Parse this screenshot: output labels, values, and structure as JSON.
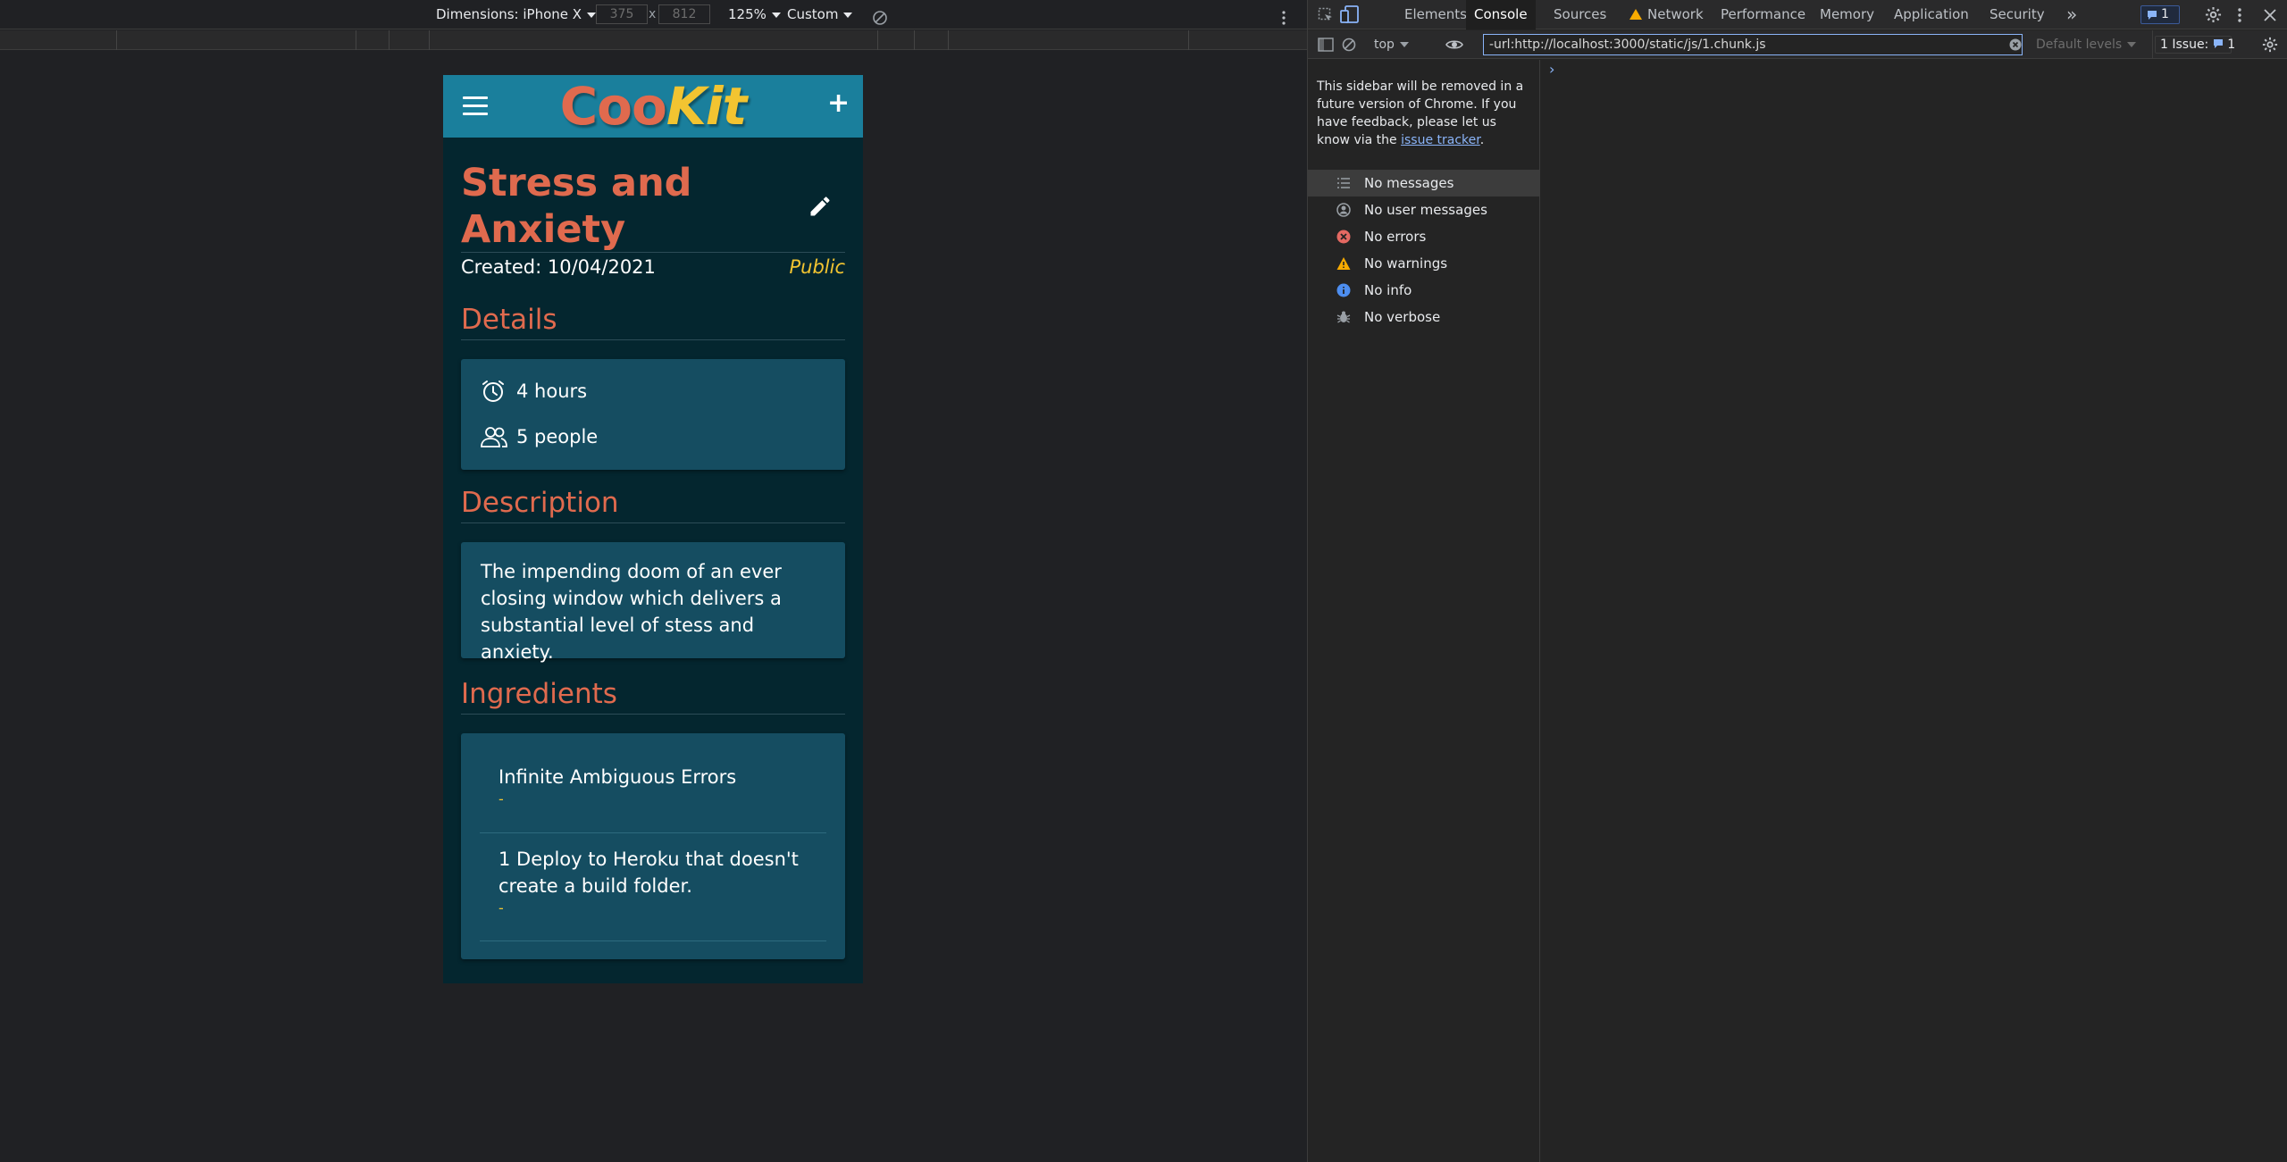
{
  "device_toolbar": {
    "dimensions_label": "Dimensions: iPhone X",
    "width_value": "375",
    "height_value": "812",
    "times": "x",
    "zoom_label": "125%",
    "throttle_label": "Custom"
  },
  "app": {
    "logo_part1": "Coo",
    "logo_part2": "Kit",
    "recipe": {
      "title": "Stress and Anxiety",
      "created": "Created: 10/04/2021",
      "visibility": "Public"
    },
    "sections": {
      "details": "Details",
      "description": "Description",
      "ingredients": "Ingredients"
    },
    "details": {
      "time": "4 hours",
      "servings": "5 people"
    },
    "description": "The impending doom of an ever closing window which delivers a substantial level of stess and anxiety.",
    "ingredients": [
      {
        "name": "Infinite Ambiguous Errors",
        "note": "-"
      },
      {
        "name": "1 Deploy to Heroku that doesn't create a build folder.",
        "note": "-"
      }
    ]
  },
  "devtools": {
    "tabs": [
      "Elements",
      "Console",
      "Sources",
      "Network",
      "Performance",
      "Memory",
      "Application",
      "Security"
    ],
    "active_tab": "Console",
    "more_tabs": "»",
    "issues_badge": "1",
    "context": "top",
    "filter_value": "-url:http://localhost:3000/static/js/1.chunk.js",
    "levels": "Default levels",
    "issues_label": "1 Issue:",
    "issues_count": "1",
    "sidebar_notice_text": "This sidebar will be removed in a future version of Chrome. If you have feedback, please let us know via the",
    "sidebar_notice_link": "issue tracker",
    "sidebar_items": [
      {
        "label": "No messages",
        "icon": "list-icon"
      },
      {
        "label": "No user messages",
        "icon": "user-icon"
      },
      {
        "label": "No errors",
        "icon": "error-icon"
      },
      {
        "label": "No warnings",
        "icon": "warning-icon"
      },
      {
        "label": "No info",
        "icon": "info-icon"
      },
      {
        "label": "No verbose",
        "icon": "verbose-icon"
      }
    ],
    "prompt": "›"
  },
  "colors": {
    "header_teal": "#1a7f9c",
    "page_bg": "#04262f",
    "card_bg": "#154d61",
    "accent_orange": "#e06a4e",
    "accent_yellow": "#f2c431"
  }
}
